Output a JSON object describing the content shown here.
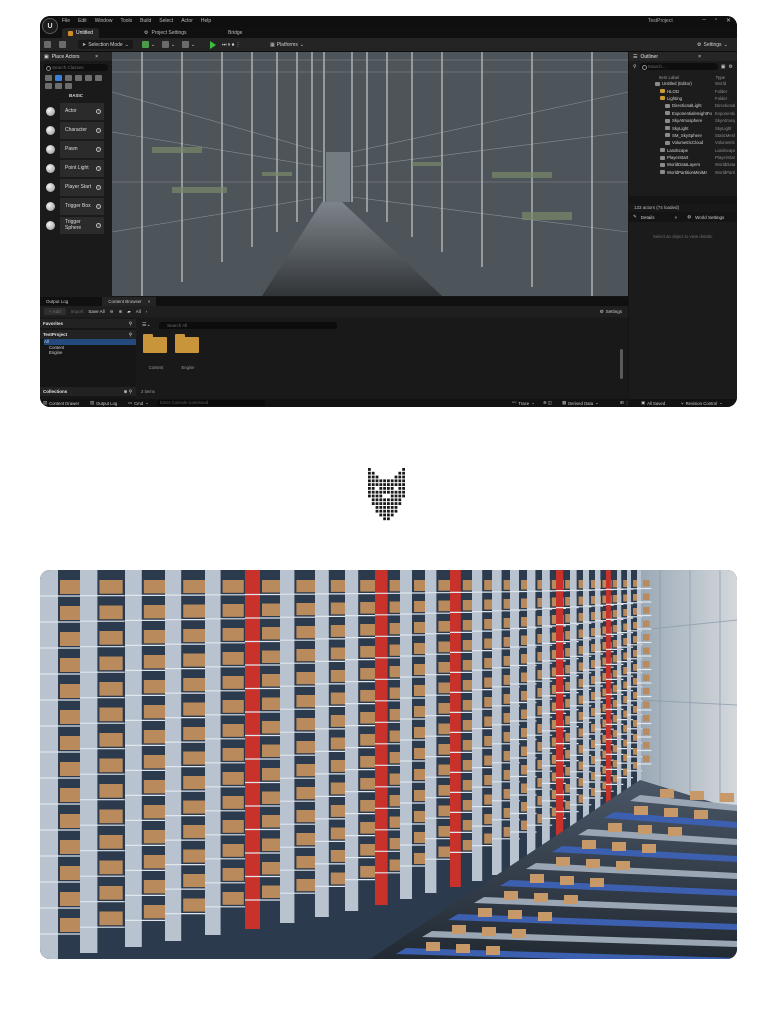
{
  "editor": {
    "menu": [
      "File",
      "Edit",
      "Window",
      "Tools",
      "Build",
      "Select",
      "Actor",
      "Help"
    ],
    "project_title": "TestProject",
    "tabs": [
      {
        "label": "Untitled",
        "active": true
      },
      {
        "label": "Project Settings",
        "active": false
      },
      {
        "label": "Bridge",
        "active": false
      }
    ],
    "toolbar": {
      "selection_mode": "Selection Mode",
      "platforms": "Platforms",
      "settings": "Settings"
    },
    "place_actors": {
      "title": "Place Actors",
      "search_placeholder": "Search Classes",
      "category": "BASIC",
      "items": [
        "Actor",
        "Character",
        "Pawn",
        "Point Light",
        "Player Start",
        "Trigger Box",
        "Trigger Sphere"
      ]
    },
    "outliner": {
      "title": "Outliner",
      "search_placeholder": "Search...",
      "col_label": "Item Label",
      "col_type": "Type",
      "rows": [
        {
          "name": "Untitled (Editor)",
          "type": "World",
          "indent": 0
        },
        {
          "name": "HLOD",
          "type": "Folder",
          "indent": 1
        },
        {
          "name": "Lighting",
          "type": "Folder",
          "indent": 1
        },
        {
          "name": "DirectionalLight",
          "type": "DirectionalLight",
          "indent": 2
        },
        {
          "name": "ExponentialHeightFog",
          "type": "ExponentialHeightFog",
          "indent": 2
        },
        {
          "name": "SkyAtmosphere",
          "type": "SkyAtmosphere",
          "indent": 2
        },
        {
          "name": "SkyLight",
          "type": "SkyLight",
          "indent": 2
        },
        {
          "name": "SM_SkySphere",
          "type": "StaticMeshActor",
          "indent": 2
        },
        {
          "name": "VolumetricCloud",
          "type": "VolumetricCloud",
          "indent": 2
        },
        {
          "name": "Landscape",
          "type": "Landscape",
          "indent": 1
        },
        {
          "name": "PlayerStart",
          "type": "PlayerStart",
          "indent": 1
        },
        {
          "name": "WorldDataLayers",
          "type": "WorldDataLayers",
          "indent": 1
        },
        {
          "name": "WorldPartitionMiniMap",
          "type": "WorldPartitionMiniMap",
          "indent": 1
        }
      ],
      "count": "133 actors (74 loaded)"
    },
    "details": {
      "tab_details": "Details",
      "tab_world": "World Settings",
      "hint": "Select an object to view details."
    },
    "content_browser": {
      "tab_output": "Output Log",
      "tab_cb": "Content Browser",
      "add": "+ Add",
      "import": "Import",
      "save_all": "Save All",
      "path_all": "All",
      "settings": "Settings",
      "favorites": "Favorites",
      "project": "TestProject",
      "tree": [
        "All",
        "Content",
        "Engine"
      ],
      "collections": "Collections",
      "search_placeholder": "Search All",
      "folders": [
        "Content",
        "Engine"
      ],
      "items_count": "2 items"
    },
    "statusbar": {
      "content_drawer": "Content Drawer",
      "output_log": "Output Log",
      "cmd": "Cmd",
      "cmd_placeholder": "Enter Console Command",
      "trace": "Trace",
      "derived_data": "Derived Data",
      "all_saved": "All Saved",
      "revision_control": "Revision Control"
    }
  }
}
